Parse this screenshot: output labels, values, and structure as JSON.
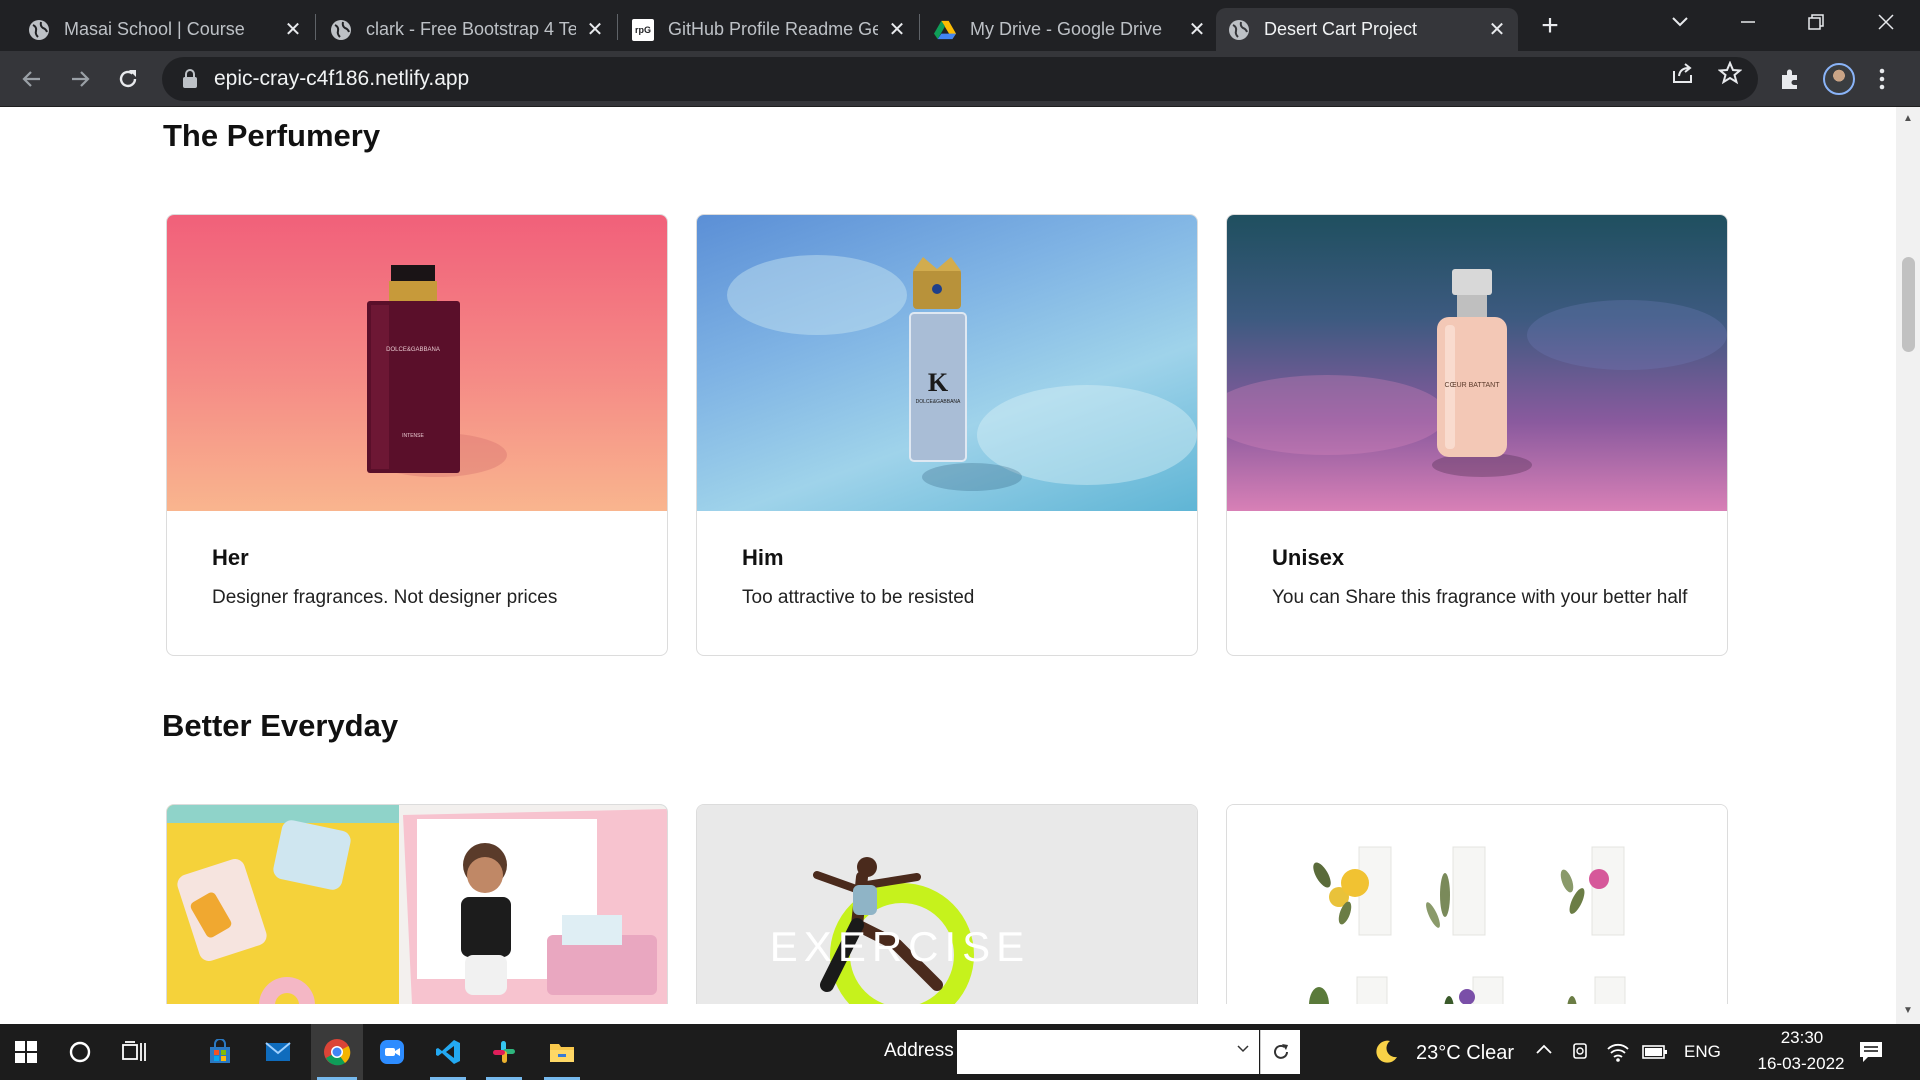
{
  "browser": {
    "tabs": [
      {
        "title": "Masai School | Course",
        "icon": "globe-icon",
        "active": false
      },
      {
        "title": "clark - Free Bootstrap 4 Te",
        "icon": "globe-icon",
        "active": false
      },
      {
        "title": "GitHub Profile Readme Ge",
        "icon": "rpg-favicon",
        "active": false
      },
      {
        "title": "My Drive - Google Drive",
        "icon": "google-drive-icon",
        "active": false
      },
      {
        "title": "Desert Cart Project",
        "icon": "globe-icon",
        "active": true
      }
    ],
    "favicon_text": "rpG",
    "close_glyph": "✕",
    "new_tab_glyph": "+",
    "url": "epic-cray-c4f186.netlify.app"
  },
  "page": {
    "perfumery": {
      "title": "The Perfumery",
      "cards": [
        {
          "heading": "Her",
          "text": "Designer fragrances. Not designer prices",
          "bottle_label": "DOLCE&GABBANA",
          "bottle_sub": "INTENSE"
        },
        {
          "heading": "Him",
          "text": "Too attractive to be resisted",
          "bottle_label": "DOLCE&GABBANA",
          "bottle_letter": "K"
        },
        {
          "heading": "Unisex",
          "text": "You can Share this fragrance with your better half",
          "bottle_label": "CŒUR BATTANT"
        }
      ]
    },
    "everyday": {
      "title": "Better Everyday",
      "exercise_text": "EXERCISE"
    }
  },
  "taskbar": {
    "address_label": "Address",
    "address_value": "",
    "weather": "23°C  Clear",
    "language": "ENG",
    "time": "23:30",
    "date": "16-03-2022"
  },
  "colors": {
    "chrome_dark": "#202124",
    "chrome_toolbar": "#35363a",
    "taskbar": "#1c1c1c",
    "accent_blue": "#76b9ed"
  }
}
